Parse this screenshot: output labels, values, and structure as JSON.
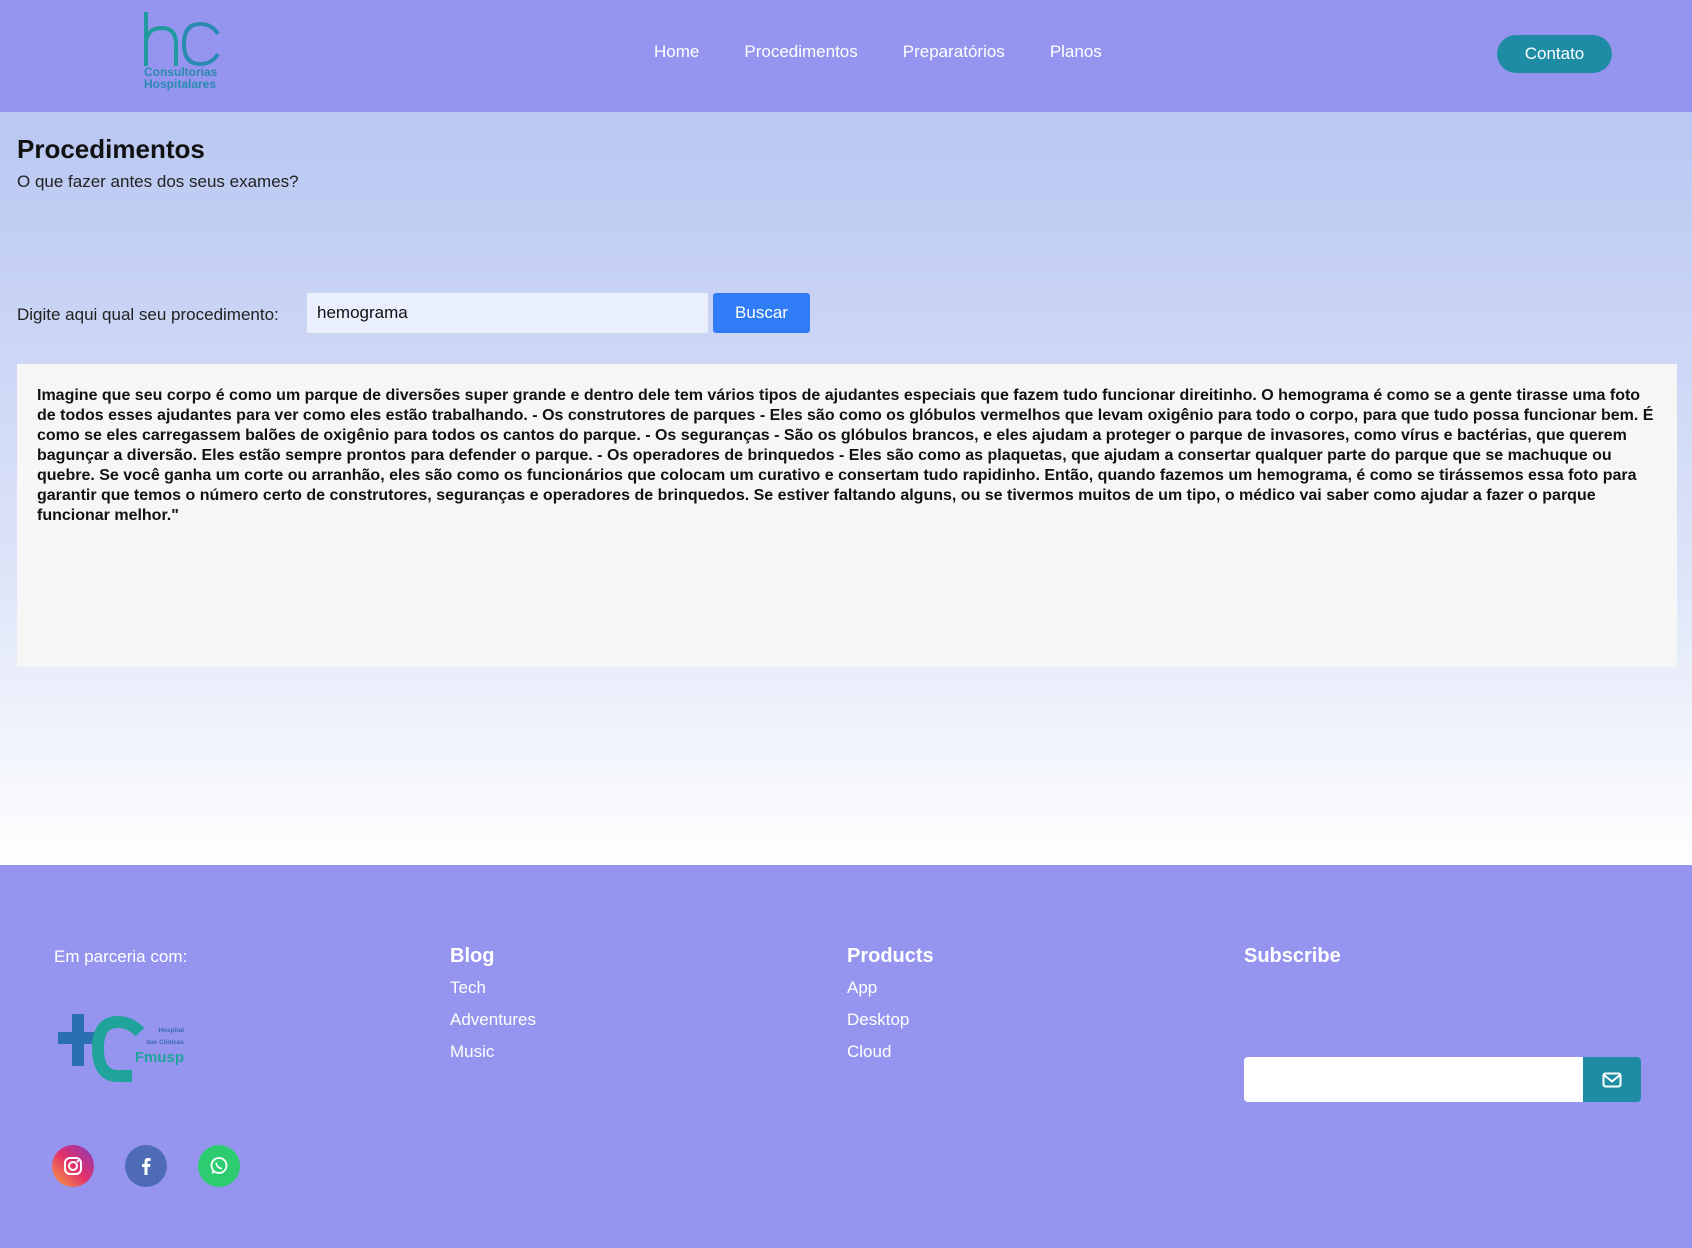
{
  "header": {
    "logo_text_line1": "Consultorias",
    "logo_text_line2": "Hospitalares",
    "nav": [
      "Home",
      "Procedimentos",
      "Preparatórios",
      "Planos"
    ],
    "contact_label": "Contato",
    "colors": {
      "bar": "#9595f0",
      "accent": "#1f8ca6"
    }
  },
  "main": {
    "title": "Procedimentos",
    "subtitle": "O que fazer antes dos seus exames?",
    "search": {
      "label": "Digite aqui qual seu procedimento:",
      "value": "hemograma",
      "button_label": "Buscar"
    },
    "result_text": "Imagine que seu corpo é como um parque de diversões super grande e dentro dele tem vários tipos de ajudantes especiais que fazem tudo funcionar direitinho. O hemograma é como se a gente tirasse uma foto de todos esses ajudantes para ver como eles estão trabalhando. - Os construtores de parques - Eles são como os glóbulos vermelhos que levam oxigênio para todo o corpo, para que tudo possa funcionar bem. É como se eles carregassem balões de oxigênio para todos os cantos do parque. - Os seguranças - São os glóbulos brancos, e eles ajudam a proteger o parque de invasores, como vírus e bactérias, que querem bagunçar a diversão. Eles estão sempre prontos para defender o parque. - Os operadores de brinquedos - Eles são como as plaquetas, que ajudam a consertar qualquer parte do parque que se machuque ou quebre. Se você ganha um corte ou arranhão, eles são como os funcionários que colocam um curativo e consertam tudo rapidinho. Então, quando fazemos um hemograma, é como se tirássemos essa foto para garantir que temos o número certo de construtores, seguranças e operadores de brinquedos. Se estiver faltando alguns, ou se tivermos muitos de um tipo, o médico vai saber como ajudar a fazer o parque funcionar melhor.\""
  },
  "footer": {
    "partner_label": "Em parceria com:",
    "partner_logo_text": {
      "line1": "Hospital",
      "line2": "das Clínicas",
      "line3": "Fmusp"
    },
    "social_icons": [
      "instagram-icon",
      "facebook-icon",
      "whatsapp-icon"
    ],
    "blog": {
      "title": "Blog",
      "links": [
        "Tech",
        "Adventures",
        "Music"
      ]
    },
    "products": {
      "title": "Products",
      "links": [
        "App",
        "Desktop",
        "Cloud"
      ]
    },
    "subscribe": {
      "title": "Subscribe",
      "icon": "envelope-icon"
    }
  }
}
